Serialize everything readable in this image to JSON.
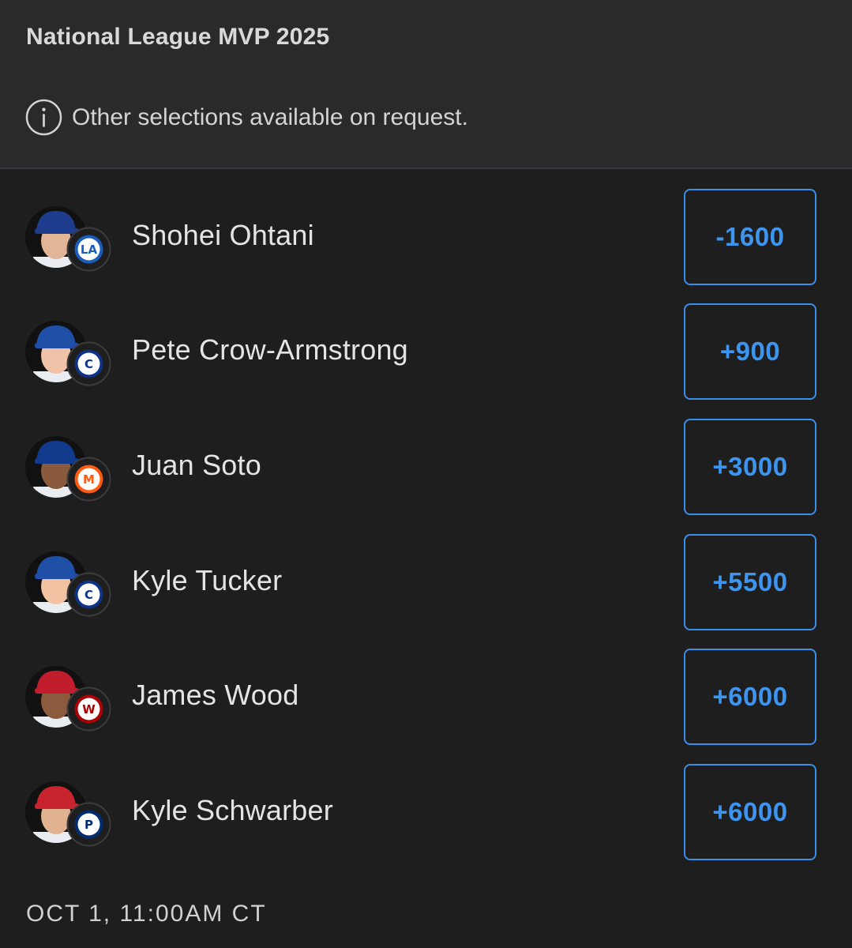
{
  "market": {
    "title": "National League MVP 2025",
    "info_text": "Other selections available on request.",
    "info_icon": "info-circle-icon"
  },
  "selections": [
    {
      "player": "Shohei Ohtani",
      "team": "Dodgers",
      "odds": "-1600",
      "cap_color": "#1e3d8f",
      "logo_color": "#1b5dbb",
      "logo_text": "LA"
    },
    {
      "player": "Pete Crow-Armstrong",
      "team": "Cubs",
      "odds": "+900",
      "cap_color": "#1f4fa6",
      "logo_color": "#0e3386",
      "logo_text": "C"
    },
    {
      "player": "Juan Soto",
      "team": "Mets",
      "odds": "+3000",
      "cap_color": "#123a8c",
      "logo_color": "#ff5910",
      "logo_text": "M"
    },
    {
      "player": "Kyle Tucker",
      "team": "Cubs",
      "odds": "+5500",
      "cap_color": "#1f4fa6",
      "logo_color": "#0e3386",
      "logo_text": "C"
    },
    {
      "player": "James Wood",
      "team": "Nationals",
      "odds": "+6000",
      "cap_color": "#c21d2c",
      "logo_color": "#ab0003",
      "logo_text": "W"
    },
    {
      "player": "Kyle Schwarber",
      "team": "Phillies",
      "odds": "+6000",
      "cap_color": "#c8242d",
      "logo_color": "#002d72",
      "logo_text": "P"
    }
  ],
  "event_time": "OCT 1, 11:00AM CT"
}
